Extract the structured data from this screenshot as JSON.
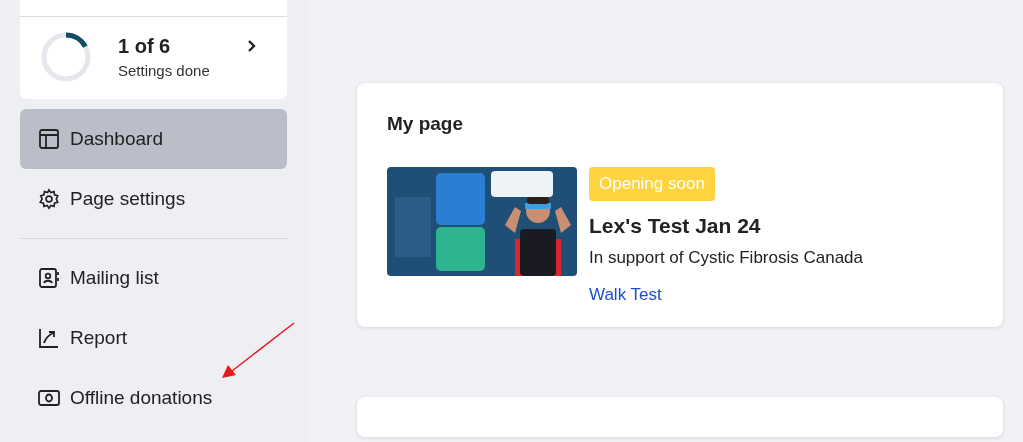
{
  "progress": {
    "title": "1 of 6",
    "subtitle": "Settings done",
    "level": 0.17
  },
  "nav_groups": [
    [
      {
        "label": "Dashboard",
        "selected": true
      },
      {
        "label": "Page settings",
        "selected": false
      }
    ],
    [
      {
        "label": "Mailing list",
        "selected": false
      },
      {
        "label": "Report",
        "selected": false
      },
      {
        "label": "Offline donations",
        "selected": false
      }
    ]
  ],
  "card": {
    "heading": "My page",
    "status": "Opening soon",
    "title": "Lex's Test Jan 24",
    "subtitle": "In support of Cystic Fibrosis Canada",
    "link": "Walk Test"
  }
}
